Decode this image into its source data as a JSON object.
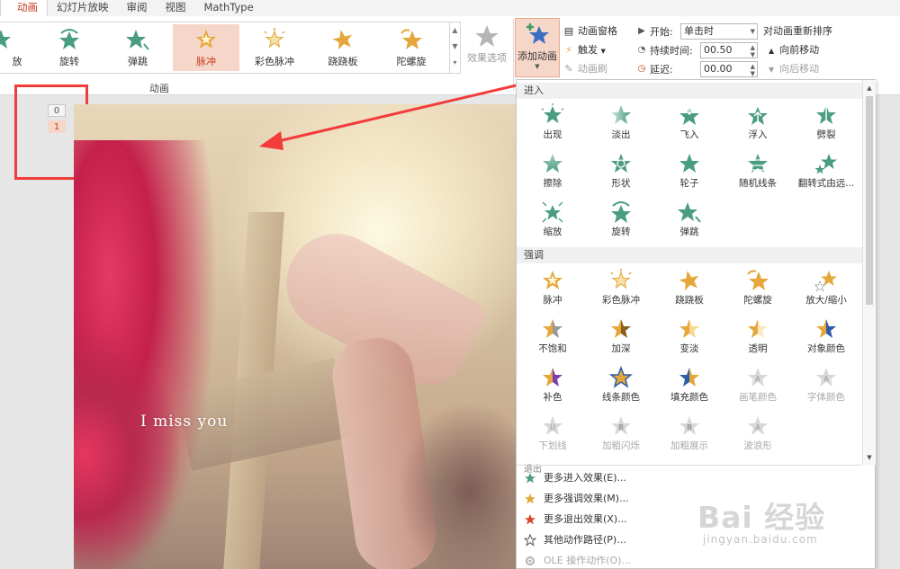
{
  "tabs": [
    "动画",
    "幻灯片放映",
    "审阅",
    "视图",
    "MathType"
  ],
  "ribbon": {
    "gallery": [
      "放",
      "旋转",
      "弹跳",
      "脉冲",
      "彩色脉冲",
      "跷跷板",
      "陀螺旋"
    ],
    "selected_gallery": "脉冲",
    "effect_options": "效果选项",
    "group_label": "动画",
    "add_animation": "添加动画",
    "animation_pane": "动画窗格",
    "trigger": "触发",
    "animation_painter": "动画刷",
    "start_label": "开始:",
    "start_value": "单击时",
    "duration_label": "持续时间:",
    "duration_value": "00.50",
    "delay_label": "延迟:",
    "delay_value": "00.00",
    "reorder_title": "对动画重新排序",
    "move_earlier": "向前移动",
    "move_later": "向后移动"
  },
  "thumbs": [
    "0",
    "1"
  ],
  "slide": {
    "caption": "I miss you"
  },
  "dropdown": {
    "enter_title": "进入",
    "enter_items": [
      "出现",
      "淡出",
      "飞入",
      "浮入",
      "劈裂",
      "擦除",
      "形状",
      "轮子",
      "随机线条",
      "翻转式由远...",
      "缩放",
      "旋转",
      "弹跳"
    ],
    "emphasis_title": "强调",
    "emphasis_items": [
      "脉冲",
      "彩色脉冲",
      "跷跷板",
      "陀螺旋",
      "放大/缩小",
      "不饱和",
      "加深",
      "变淡",
      "透明",
      "对象颜色",
      "补色",
      "线条颜色",
      "填充颜色",
      "画笔颜色",
      "字体颜色",
      "下划线",
      "加粗闪烁",
      "加粗展示",
      "波浪形"
    ],
    "exit_title_cut": "退出",
    "more_items": [
      "更多进入效果(E)...",
      "更多强调效果(M)...",
      "更多退出效果(X)...",
      "其他动作路径(P)...",
      "OLE 操作动作(O)..."
    ]
  },
  "colors": {
    "accent": "#c43e1c",
    "selected_bg": "#f6d6c8",
    "enter_star": "#4a9d7f",
    "emphasis_star": "#e5a63a",
    "exit_star": "#d9482c",
    "highlight_red": "#f23b3b"
  },
  "watermark": {
    "line1": "Bai 经验",
    "line2": "jingyan.baidu.com"
  }
}
